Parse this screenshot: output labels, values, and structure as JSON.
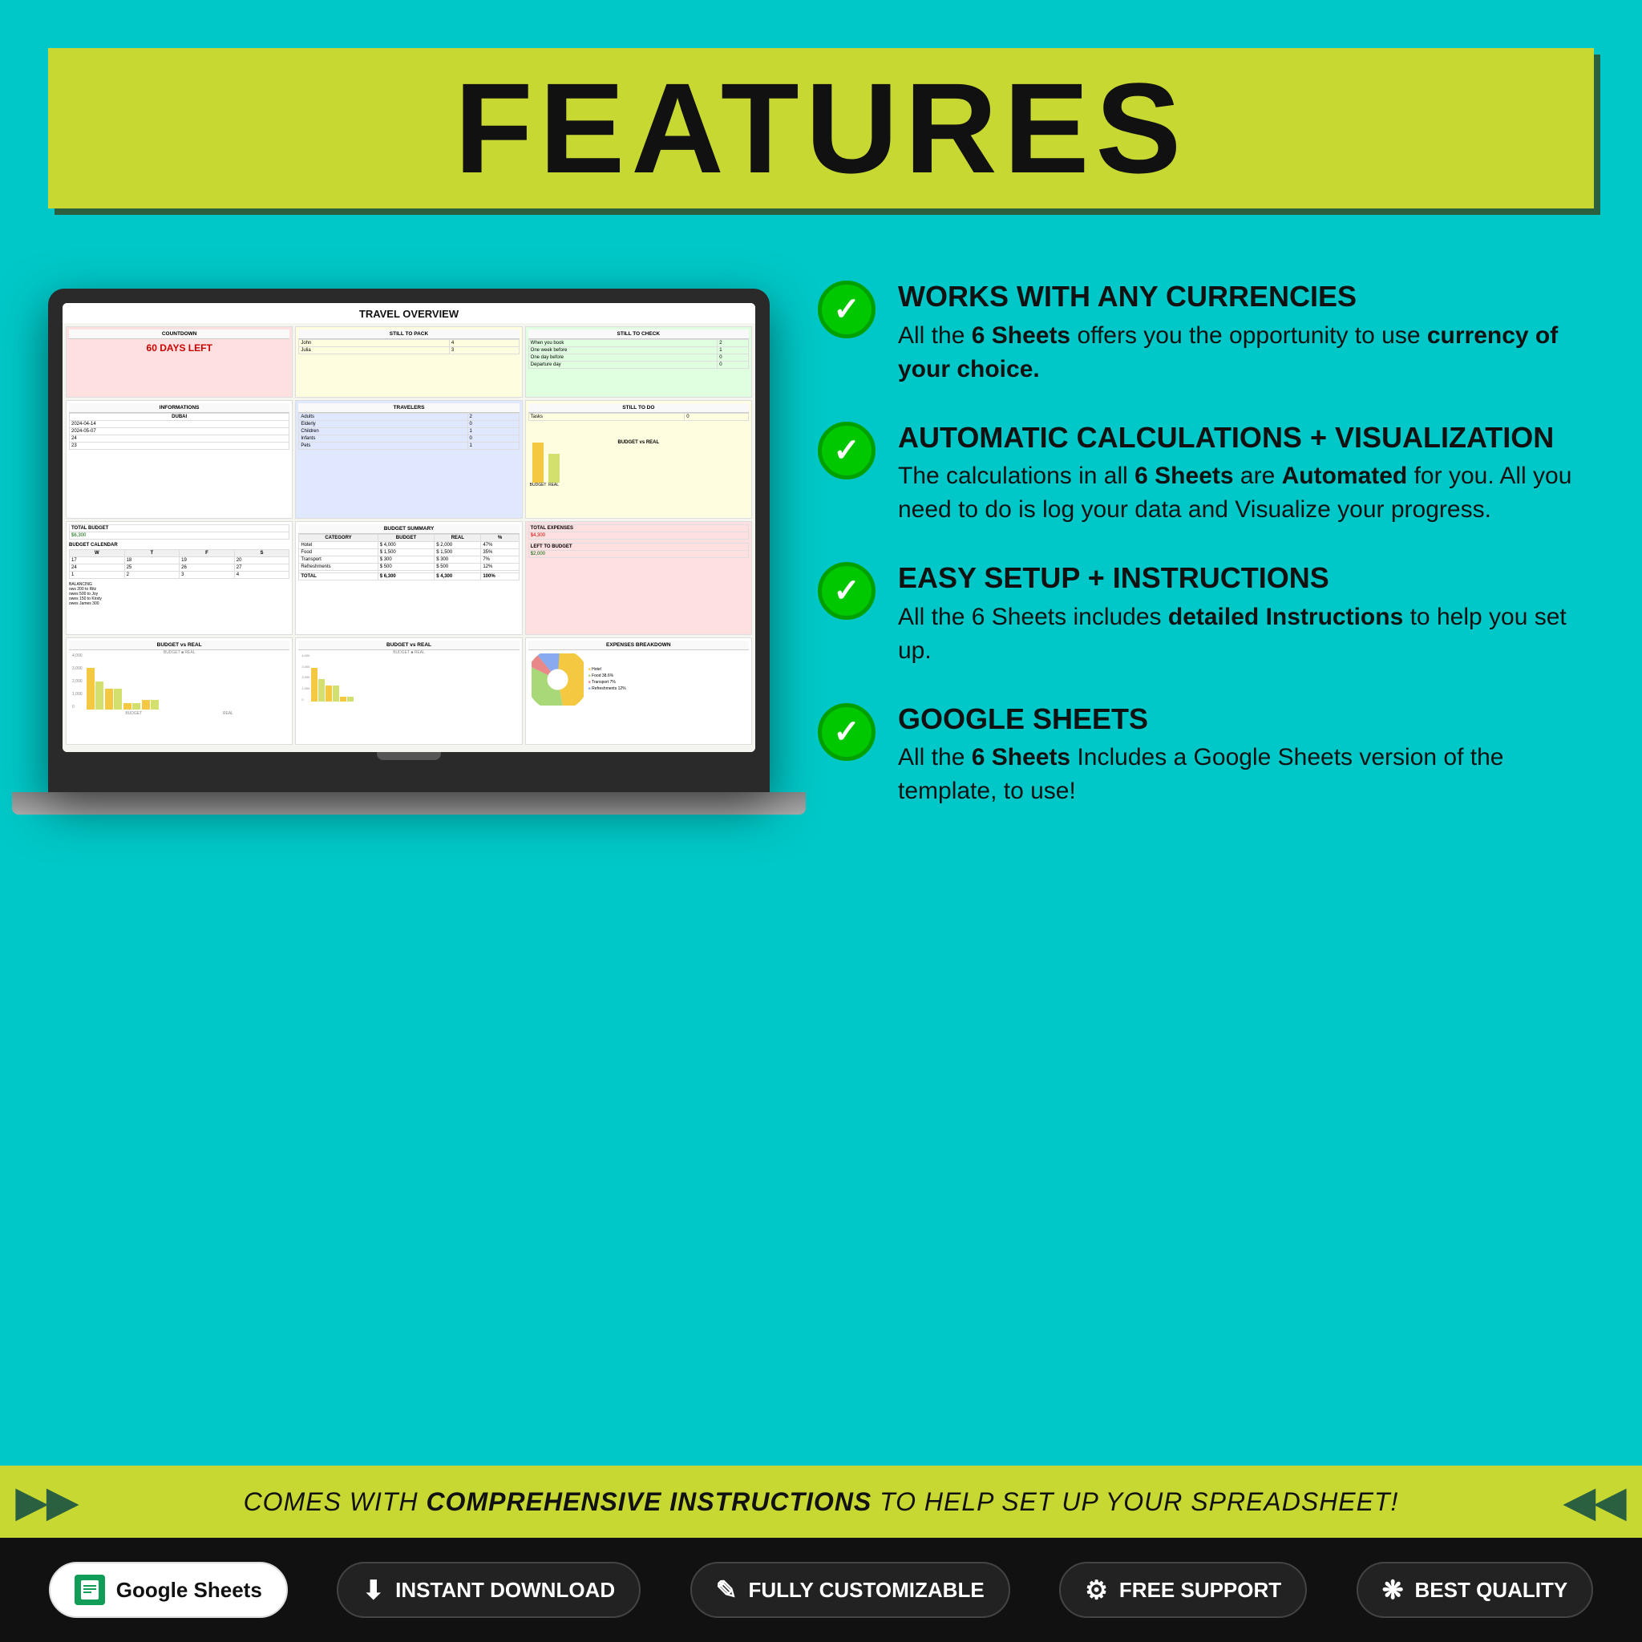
{
  "header": {
    "title": "FEATURES"
  },
  "spreadsheet": {
    "title": "TRAVEL OVERVIEW",
    "countdown": {
      "label": "COUNTDOWN",
      "days": "60 DAYS LEFT"
    },
    "informations": {
      "label": "INFORMATIONS",
      "destination": "DUBAI",
      "date1": "2024-04-14",
      "date2": "2024-05-07",
      "days": "24",
      "nights": "23"
    },
    "travelers": {
      "label": "TRAVELERS",
      "adults": "Adults 2",
      "elderly": "Elderly 0",
      "children": "Children 1",
      "infants": "Infants 0",
      "pets": "Pets 1"
    },
    "still_to_pack": {
      "label": "STILL TO PACK",
      "john": "John 4",
      "julia": "Julia 3"
    },
    "still_to_check": {
      "label": "STILL TO CHECK",
      "when_book": "When you book 2",
      "one_week": "One week before 1",
      "one_day": "One day before 0",
      "departure": "Departure day 0"
    },
    "total_budget": {
      "label": "TOTAL BUDGET",
      "value": "$6,300"
    },
    "total_expenses": {
      "label": "TOTAL EXPENSES",
      "value": "$4,300"
    },
    "left_to_budget": {
      "label": "LEFT TO BUDGET",
      "value": "$2,000"
    },
    "still_to_do": {
      "label": "STILL TO DO",
      "tasks": "Tasks 0"
    },
    "budget_summary_title": "BUDGET SUMMARY",
    "budget_vs_real_title": "BUDGET vs REAL",
    "expenses_breakdown_title": "EXPENSES BREAKDOWN"
  },
  "features": [
    {
      "id": "currencies",
      "title": "WORKS WITH ANY CURRENCIES",
      "description_parts": [
        {
          "text": "All the ",
          "bold": false
        },
        {
          "text": "6 Sheets",
          "bold": true
        },
        {
          "text": " offers you the opportunity to use ",
          "bold": false
        },
        {
          "text": "currency of your choice.",
          "bold": true
        }
      ]
    },
    {
      "id": "calculations",
      "title": "AUTOMATIC CALCULATIONS + VISUALIZATION",
      "description_parts": [
        {
          "text": "The calculations in all ",
          "bold": false
        },
        {
          "text": "6 Sheets",
          "bold": true
        },
        {
          "text": " are ",
          "bold": false
        },
        {
          "text": "Automated",
          "bold": true
        },
        {
          "text": " for you. All you need to do is log your data and Visualize your progress.",
          "bold": false
        }
      ]
    },
    {
      "id": "setup",
      "title": "EASY SETUP + INSTRUCTIONS",
      "description_parts": [
        {
          "text": "All the 6 Sheets includes ",
          "bold": false
        },
        {
          "text": "detailed Instructions",
          "bold": true
        },
        {
          "text": " to help you set up.",
          "bold": false
        }
      ]
    },
    {
      "id": "google",
      "title": "GOOGLE SHEETS",
      "description_parts": [
        {
          "text": "All the ",
          "bold": false
        },
        {
          "text": "6 Sheets",
          "bold": true
        },
        {
          "text": " Includes a Google Sheets version of the template, to use!",
          "bold": false
        }
      ]
    }
  ],
  "bottom_banner": {
    "text_before": "COMES WITH ",
    "text_bold": "COMPREHENSIVE INSTRUCTIONS",
    "text_after": " TO HELP SET UP YOUR SPREADSHEET!"
  },
  "footer_badges": [
    {
      "id": "google-sheets",
      "label": "Google Sheets",
      "type": "google"
    },
    {
      "id": "instant-download",
      "label": "INSTANT DOWNLOAD",
      "icon": "⬇"
    },
    {
      "id": "fully-customizable",
      "label": "FULLY CUSTOMIZABLE",
      "icon": "✎"
    },
    {
      "id": "free-support",
      "label": "FREE SUPPORT",
      "icon": "⚙"
    },
    {
      "id": "best-quality",
      "label": "BEST QUALITY",
      "icon": "✦"
    }
  ]
}
